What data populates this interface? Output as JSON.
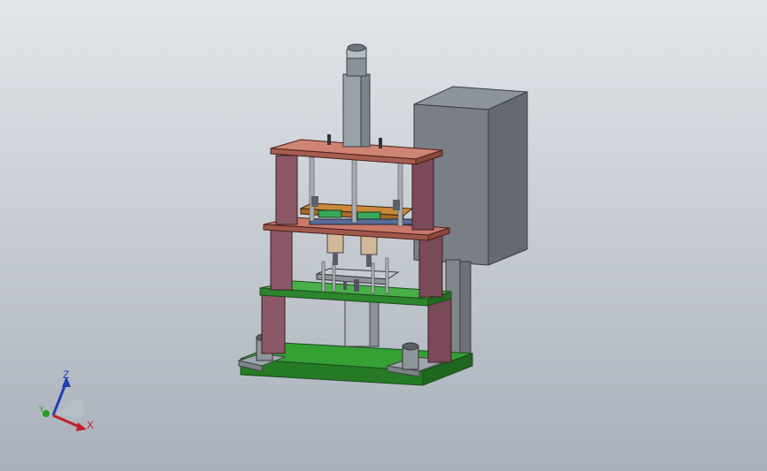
{
  "viewport": {
    "view": "isometric",
    "background_top": "#e3e6ea",
    "background_bottom": "#a9b0ba"
  },
  "model": {
    "colors": {
      "base_plate": "#2e8b2e",
      "middle_plate": "#3a9a3a",
      "upper_plates": "#b46a5c",
      "columns": "#8a5866",
      "housing": "#7a7f87",
      "blocks": "#c98a3a",
      "rods": "#9aa0a8"
    }
  },
  "triad": {
    "x_label": "X",
    "y_label": "Y",
    "z_label": "Z",
    "colors": {
      "x": "#c0202a",
      "y": "#2a9a2a",
      "z": "#1f3fb0"
    }
  }
}
